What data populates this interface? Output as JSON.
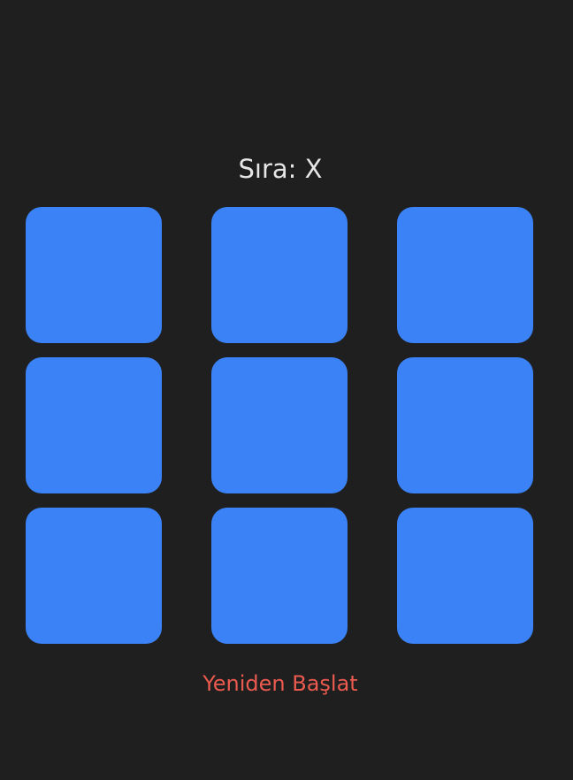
{
  "status": {
    "turn_text": "Sıra: X"
  },
  "board": {
    "cells": [
      "",
      "",
      "",
      "",
      "",
      "",
      "",
      "",
      ""
    ]
  },
  "actions": {
    "restart_label": "Yeniden Başlat"
  },
  "colors": {
    "background": "#1f1f1f",
    "cell": "#3a82f6",
    "status_text": "#e6e6e6",
    "restart_text": "#ea5a4e"
  }
}
